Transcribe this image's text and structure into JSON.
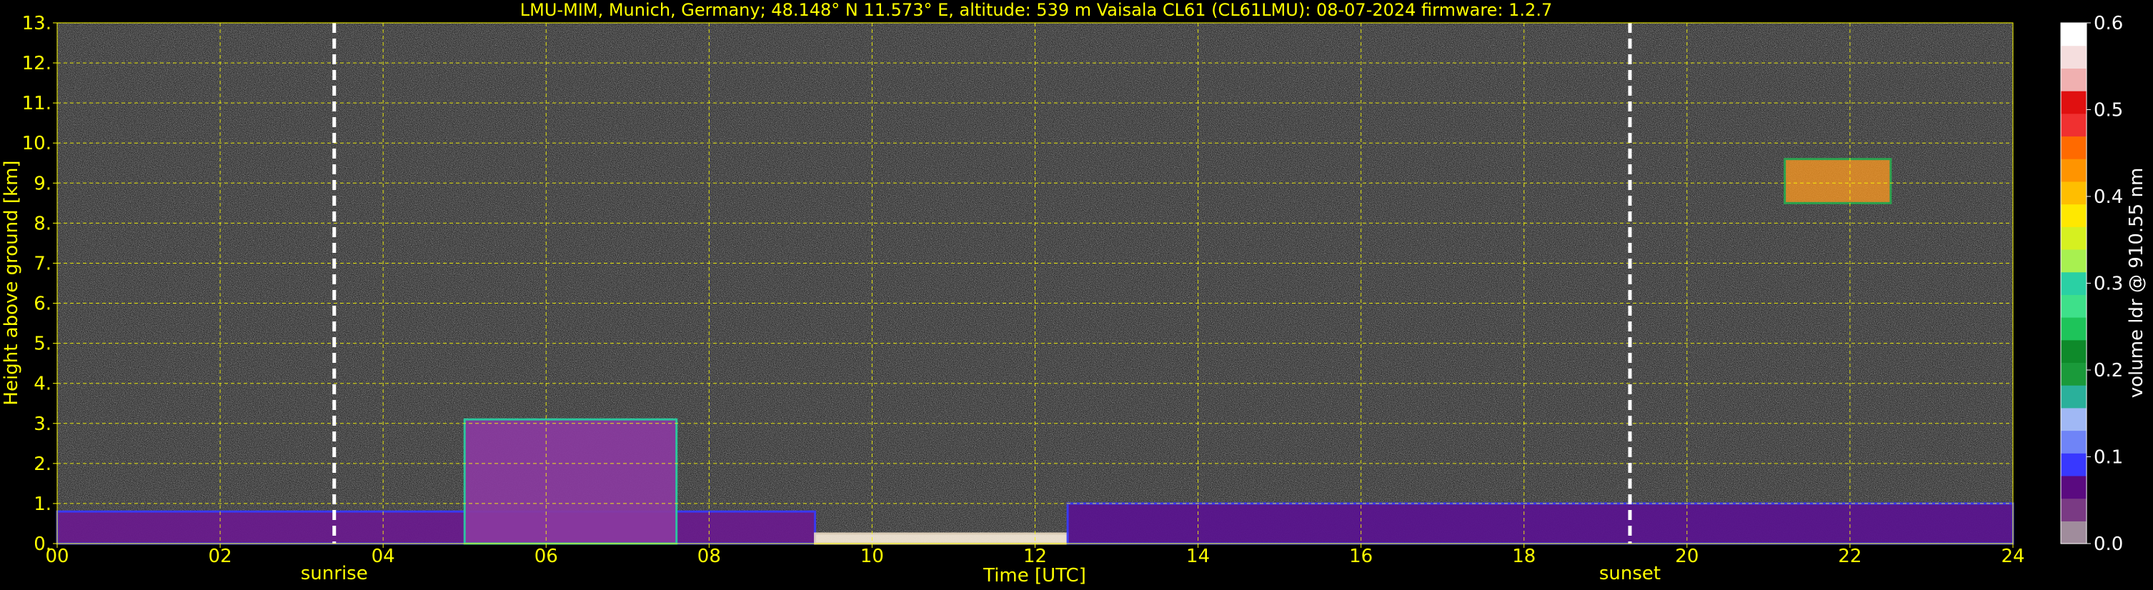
{
  "chart_data": {
    "type": "heatmap",
    "title": "LMU-MIM, Munich, Germany; 48.148° N 11.573° E, altitude: 539 m    Vaisala CL61 (CL61LMU): 08-07-2024    firmware: 1.2.7",
    "xlabel": "Time [UTC]",
    "ylabel": "Height above ground [km]",
    "xlim": [
      0,
      24
    ],
    "ylim": [
      0,
      13
    ],
    "x_ticks": [
      0,
      2,
      4,
      6,
      8,
      10,
      12,
      14,
      16,
      18,
      20,
      22,
      24
    ],
    "x_tick_labels": [
      "00",
      "02",
      "04",
      "06",
      "08",
      "10",
      "12",
      "14",
      "16",
      "18",
      "20",
      "22",
      "24"
    ],
    "y_ticks": [
      0,
      1,
      2,
      3,
      4,
      5,
      6,
      7,
      8,
      9,
      10,
      11,
      12,
      13
    ],
    "y_tick_labels": [
      "0.",
      "1.",
      "2.",
      "3.",
      "4.",
      "5.",
      "6.",
      "7.",
      "8.",
      "9.",
      "10.",
      "11.",
      "12.",
      "13."
    ],
    "grid": true,
    "grid_color": "#ffff00",
    "text_color": "#ffff00",
    "background": "#000000",
    "annotations": [
      {
        "label": "sunrise",
        "time": 3.4
      },
      {
        "label": "sunset",
        "time": 19.3
      }
    ],
    "colorbar": {
      "label": "volume ldr @ 910.55 nm",
      "range": [
        0.0,
        0.6
      ],
      "ticks": [
        0.0,
        0.1,
        0.2,
        0.3,
        0.4,
        0.5,
        0.6
      ],
      "tick_labels": [
        "0.0",
        "0.1",
        "0.2",
        "0.3",
        "0.4",
        "0.5",
        "0.6"
      ],
      "colors": [
        "#a08c9c",
        "#7a3a84",
        "#5a0a80",
        "#3838ff",
        "#6f84f7",
        "#a0b8f5",
        "#2ab09b",
        "#1a9a3a",
        "#0e8a2a",
        "#1ec45a",
        "#3ee08a",
        "#2ad0a4",
        "#a8f050",
        "#d6f020",
        "#ffe800",
        "#ffbe00",
        "#ff9400",
        "#ff6a00",
        "#f03030",
        "#e01010",
        "#f0b0b0",
        "#f5dede",
        "#ffffff"
      ]
    },
    "features": [
      {
        "name": "boundary layer",
        "t_start": 0,
        "t_end": 9.3,
        "top_km": 0.8
      },
      {
        "name": "convective plumes",
        "t_start": 5.0,
        "t_end": 7.6,
        "top_km": 3.1
      },
      {
        "name": "bright surface band",
        "t_start": 9.3,
        "t_end": 12.4,
        "top_km": 0.25
      },
      {
        "name": "boundary layer",
        "t_start": 12.4,
        "t_end": 24,
        "top_km": 1.0
      },
      {
        "name": "elevated feature",
        "t_start": 21.2,
        "t_end": 22.5,
        "bottom_km": 8.5,
        "top_km": 9.6
      }
    ]
  }
}
